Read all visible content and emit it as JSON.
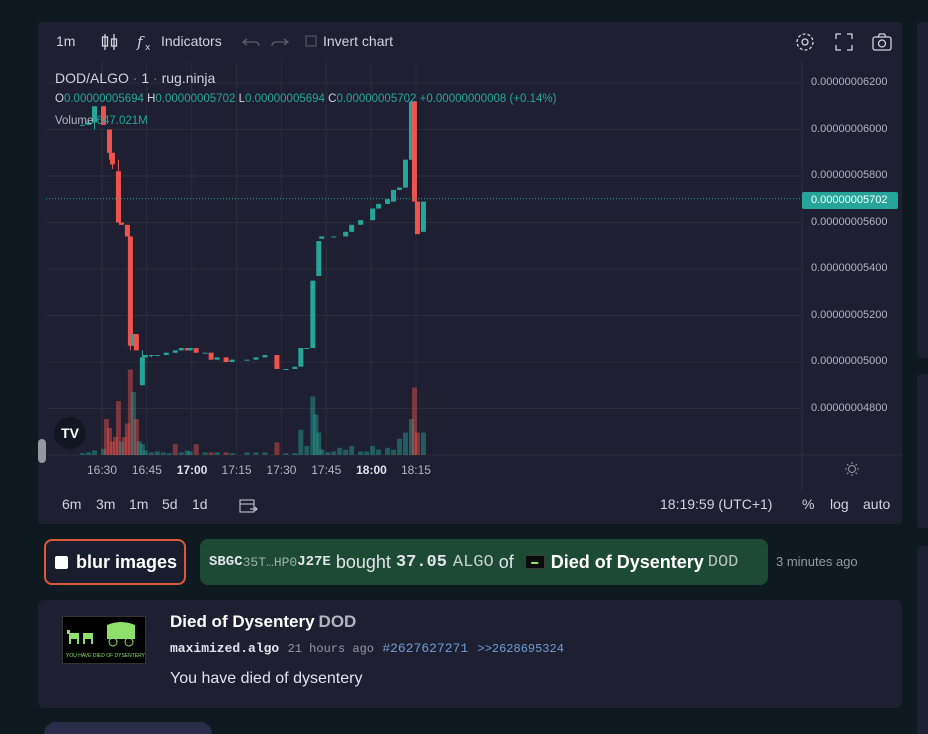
{
  "toolbar": {
    "interval": "1m",
    "indicators_label": "Indicators",
    "invert_chart_label": "Invert chart",
    "icons": [
      "candles-icon",
      "fx-icon",
      "undo-icon",
      "redo-icon",
      "settings-icon",
      "fullscreen-icon",
      "camera-icon"
    ]
  },
  "legend": {
    "pair": "DOD/ALGO",
    "interval": "1",
    "source": "rug.ninja",
    "o_key": "O",
    "o_val": "0.00000005694",
    "h_key": "H",
    "h_val": "0.00000005702",
    "l_key": "L",
    "l_val": "0.00000005694",
    "c_key": "C",
    "c_val": "0.00000005702",
    "change": "+0.00000000008 (+0.14%)",
    "volume_key": "Volume",
    "volume_val": "647.021M"
  },
  "price_axis": {
    "current_price": "0.00000005702"
  },
  "time_axis": {
    "clock": "18:19:59 (UTC+1)",
    "ranges": [
      "6m",
      "3m",
      "1m",
      "5d",
      "1d"
    ],
    "pct_label": "%",
    "log_label": "log",
    "auto_label": "auto"
  },
  "colors": {
    "up": "#26a69a",
    "down": "#ef5350",
    "bg": "#1e1f30",
    "trade_bg": "#1d4a34",
    "blur_border": "#d95a3b"
  },
  "chart_data": {
    "type": "candlestick",
    "y_ticks": [
      "0.00000006200",
      "0.00000006000",
      "0.00000005800",
      "0.00000005600",
      "0.00000005400",
      "0.00000005200",
      "0.00000005000",
      "0.00000004800"
    ],
    "y_values": [
      6.2e-08,
      6e-08,
      5.8e-08,
      5.6e-08,
      5.4e-08,
      5.2e-08,
      5e-08,
      4.8e-08
    ],
    "x_ticks": [
      {
        "label": "16:30",
        "bold": false,
        "t": 0
      },
      {
        "label": "16:45",
        "bold": false,
        "t": 15
      },
      {
        "label": "17:00",
        "bold": true,
        "t": 30
      },
      {
        "label": "17:15",
        "bold": false,
        "t": 45
      },
      {
        "label": "17:30",
        "bold": false,
        "t": 60
      },
      {
        "label": "17:45",
        "bold": false,
        "t": 75
      },
      {
        "label": "18:00",
        "bold": true,
        "t": 90
      },
      {
        "label": "18:15",
        "bold": false,
        "t": 105
      }
    ],
    "candles": [
      [
        -6.5,
        6.02,
        6.02,
        6.02,
        6.02
      ],
      [
        -4.5,
        6.02,
        6.04,
        6.02,
        6.03
      ],
      [
        -2.5,
        6.03,
        6.1,
        6.0,
        6.1
      ],
      [
        0.5,
        6.1,
        6.1,
        6.02,
        6.02
      ],
      [
        2.5,
        6.0,
        6.0,
        5.87,
        5.9
      ],
      [
        3.5,
        5.9,
        5.9,
        5.83,
        5.85
      ],
      [
        5.5,
        5.82,
        5.87,
        5.6,
        5.6
      ],
      [
        6.5,
        5.6,
        5.6,
        5.59,
        5.59
      ],
      [
        8.5,
        5.59,
        5.59,
        5.54,
        5.54
      ],
      [
        9.5,
        5.54,
        5.54,
        5.05,
        5.07
      ],
      [
        10.5,
        5.07,
        5.12,
        5.07,
        5.12
      ],
      [
        11.5,
        5.12,
        5.12,
        5.05,
        5.05
      ],
      [
        13.5,
        4.9,
        5.05,
        4.9,
        5.02
      ],
      [
        14.5,
        5.02,
        5.03,
        5.02,
        5.03
      ],
      [
        16.5,
        5.03,
        5.03,
        5.02,
        5.03
      ],
      [
        18.5,
        5.03,
        5.03,
        5.03,
        5.03
      ],
      [
        21.5,
        5.03,
        5.04,
        5.03,
        5.04
      ],
      [
        24.5,
        5.04,
        5.05,
        5.04,
        5.05
      ],
      [
        26.5,
        5.05,
        5.06,
        5.05,
        5.06
      ],
      [
        28.5,
        5.06,
        5.06,
        5.05,
        5.05
      ],
      [
        29.5,
        5.05,
        5.06,
        5.05,
        5.06
      ],
      [
        31.5,
        5.06,
        5.06,
        5.04,
        5.04
      ],
      [
        34.5,
        5.04,
        5.04,
        5.04,
        5.04
      ],
      [
        36.5,
        5.04,
        5.04,
        5.01,
        5.01
      ],
      [
        38.5,
        5.01,
        5.02,
        5.01,
        5.02
      ],
      [
        41.5,
        5.02,
        5.02,
        5.0,
        5.0
      ],
      [
        43.5,
        5.0,
        5.01,
        5.0,
        5.01
      ],
      [
        48.5,
        5.01,
        5.01,
        5.01,
        5.01
      ],
      [
        51.5,
        5.01,
        5.02,
        5.01,
        5.02
      ],
      [
        54.5,
        5.02,
        5.03,
        5.02,
        5.03
      ],
      [
        58.5,
        5.03,
        5.03,
        4.97,
        4.97
      ],
      [
        61.5,
        4.97,
        4.97,
        4.97,
        4.97
      ],
      [
        64.5,
        4.97,
        4.98,
        4.97,
        4.98
      ],
      [
        66.5,
        4.98,
        5.06,
        4.98,
        5.06
      ],
      [
        68.5,
        5.06,
        5.06,
        5.06,
        5.06
      ],
      [
        70.5,
        5.06,
        5.35,
        5.06,
        5.35
      ],
      [
        72.5,
        5.37,
        5.52,
        5.37,
        5.52
      ],
      [
        73.5,
        5.53,
        5.54,
        5.53,
        5.54
      ],
      [
        77.5,
        5.54,
        5.54,
        5.54,
        5.54
      ],
      [
        81.5,
        5.54,
        5.56,
        5.54,
        5.56
      ],
      [
        83.5,
        5.56,
        5.59,
        5.56,
        5.59
      ],
      [
        86.5,
        5.59,
        5.61,
        5.59,
        5.61
      ],
      [
        90.5,
        5.61,
        5.66,
        5.61,
        5.66
      ],
      [
        92.5,
        5.66,
        5.68,
        5.66,
        5.68
      ],
      [
        95.5,
        5.68,
        5.7,
        5.68,
        5.7
      ],
      [
        97.5,
        5.69,
        5.74,
        5.69,
        5.74
      ],
      [
        99.5,
        5.74,
        5.75,
        5.74,
        5.75
      ],
      [
        101.5,
        5.75,
        5.87,
        5.75,
        5.87
      ],
      [
        103.5,
        5.87,
        6.12,
        5.87,
        6.12
      ],
      [
        104.5,
        6.12,
        6.12,
        5.69,
        5.69
      ],
      [
        105.5,
        5.69,
        5.69,
        5.55,
        5.55
      ],
      [
        107.5,
        5.56,
        5.69,
        5.56,
        5.69
      ]
    ],
    "volume": [
      [
        -6.5,
        2
      ],
      [
        -4.5,
        3
      ],
      [
        -2.5,
        5
      ],
      [
        0.5,
        7
      ],
      [
        1.5,
        40
      ],
      [
        2.5,
        30
      ],
      [
        3.5,
        15
      ],
      [
        4.5,
        20
      ],
      [
        5.5,
        60
      ],
      [
        6.5,
        15
      ],
      [
        7.5,
        20
      ],
      [
        8.5,
        35
      ],
      [
        9.5,
        95
      ],
      [
        10.5,
        70
      ],
      [
        11.5,
        40
      ],
      [
        12.5,
        15
      ],
      [
        13.5,
        12
      ],
      [
        14.5,
        5
      ],
      [
        16.5,
        3
      ],
      [
        18.5,
        4
      ],
      [
        20.5,
        3
      ],
      [
        22.5,
        2
      ],
      [
        24.5,
        12
      ],
      [
        26.5,
        3
      ],
      [
        28.5,
        5
      ],
      [
        29.5,
        4
      ],
      [
        31.5,
        12
      ],
      [
        34.5,
        3
      ],
      [
        36.5,
        3
      ],
      [
        38.5,
        3
      ],
      [
        41.5,
        3
      ],
      [
        43.5,
        2
      ],
      [
        48.5,
        3
      ],
      [
        51.5,
        3
      ],
      [
        54.5,
        3
      ],
      [
        58.5,
        14
      ],
      [
        61.5,
        2
      ],
      [
        64.5,
        2
      ],
      [
        66.5,
        28
      ],
      [
        68.5,
        10
      ],
      [
        70.5,
        65
      ],
      [
        71.5,
        45
      ],
      [
        72.5,
        25
      ],
      [
        73.5,
        6
      ],
      [
        75.5,
        3
      ],
      [
        77.5,
        4
      ],
      [
        79.5,
        8
      ],
      [
        81.5,
        6
      ],
      [
        83.5,
        10
      ],
      [
        86.5,
        4
      ],
      [
        88.5,
        4
      ],
      [
        90.5,
        10
      ],
      [
        92.5,
        6
      ],
      [
        95.5,
        8
      ],
      [
        97.5,
        6
      ],
      [
        99.5,
        18
      ],
      [
        101.5,
        25
      ],
      [
        103.5,
        40
      ],
      [
        104.5,
        75
      ],
      [
        105.5,
        25
      ],
      [
        107.5,
        25
      ]
    ],
    "down_volume_ts": [
      1.5,
      2.5,
      3.5,
      4.5,
      5.5,
      7.5,
      8.5,
      9.5,
      11.5,
      24.5,
      31.5,
      36.5,
      41.5,
      58.5,
      104.5,
      105.5
    ]
  },
  "trade": {
    "addr_prefix": "SBGC",
    "addr_mid": "35T…HP0",
    "addr_suffix": "J27E",
    "bought": "bought",
    "amount": "37.05",
    "asset": "ALGO",
    "of": "of",
    "token_name": "Died of Dysentery",
    "token_unit": "DOD",
    "time": "3 minutes ago"
  },
  "blur": {
    "label": "blur images"
  },
  "card": {
    "title": "Died of Dysentery",
    "unit": "DOD",
    "creator": "maximized.algo",
    "ago": "21 hours ago",
    "asa_id": "#2627627271",
    "asa_link": ">>2628695324",
    "description": "You have died of dysentery",
    "logo_text": "YOU HAVE DIED OF DYSENTERY"
  }
}
